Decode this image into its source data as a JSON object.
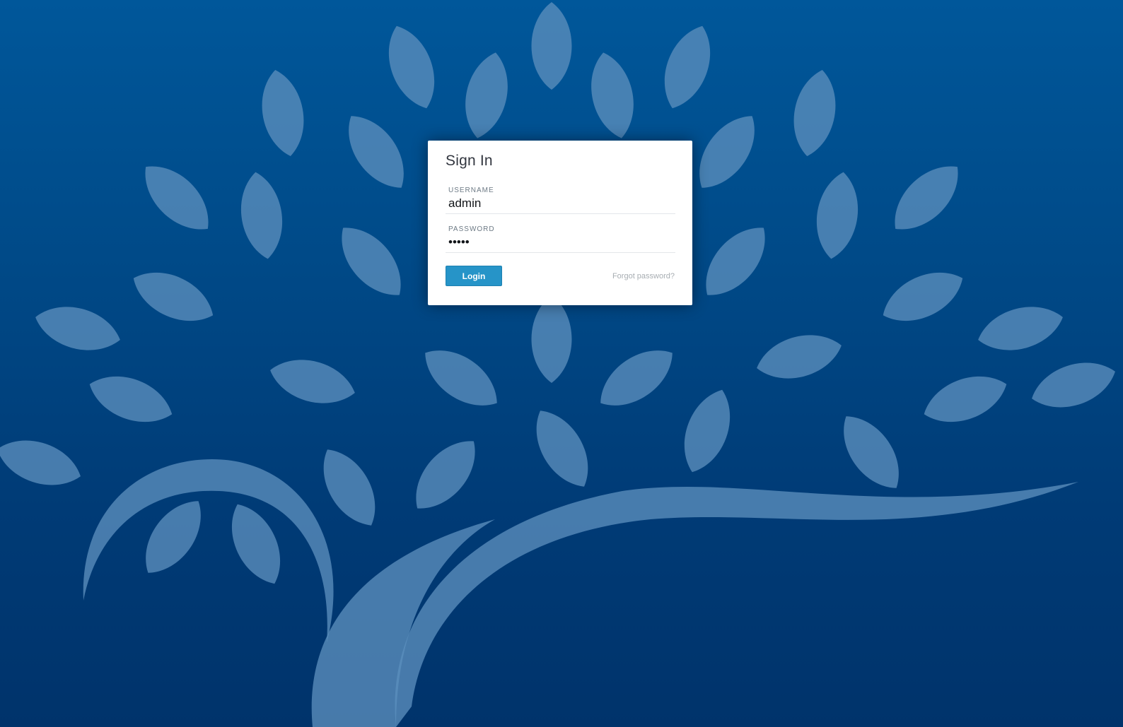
{
  "login_card": {
    "title": "Sign In",
    "username": {
      "label": "USERNAME",
      "value": "admin"
    },
    "password": {
      "label": "PASSWORD",
      "value": "admin"
    },
    "login_button_label": "Login",
    "forgot_password_label": "Forgot password?"
  },
  "colors": {
    "background_top": "#00579a",
    "background_bottom": "#00336b",
    "tree_art": "#5b8ebd",
    "login_button": "#2694c8"
  },
  "background_icon": "tree-icon"
}
